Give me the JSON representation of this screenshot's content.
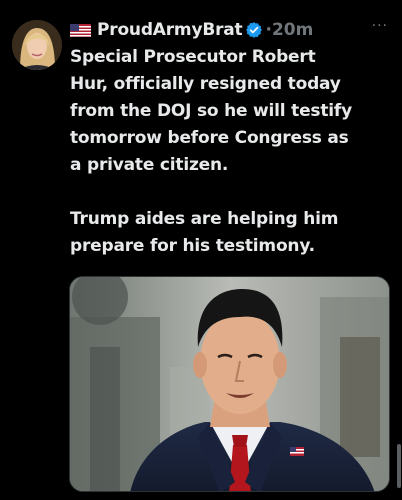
{
  "tweet": {
    "author": {
      "display_name": "ProudArmyBrat",
      "flag_icon": "us-flag-icon",
      "verified": true,
      "verified_color": "#1d9bf0",
      "avatar_icon": "profile-avatar"
    },
    "timestamp": "·20m",
    "more_label": "···",
    "paragraphs": [
      "Special Prosecutor Robert\nHur, officially resigned today\nfrom the DOJ so he will testify\ntomorrow before Congress as\na private citizen.",
      "Trump aides are helping him\nprepare for his testimony."
    ],
    "media": {
      "type": "photo",
      "subject": "man-in-suit-with-flag-pin"
    }
  },
  "colors": {
    "background": "#000000",
    "text_primary": "#e7e9ea",
    "text_secondary": "#71767b",
    "border": "#2f3336"
  }
}
